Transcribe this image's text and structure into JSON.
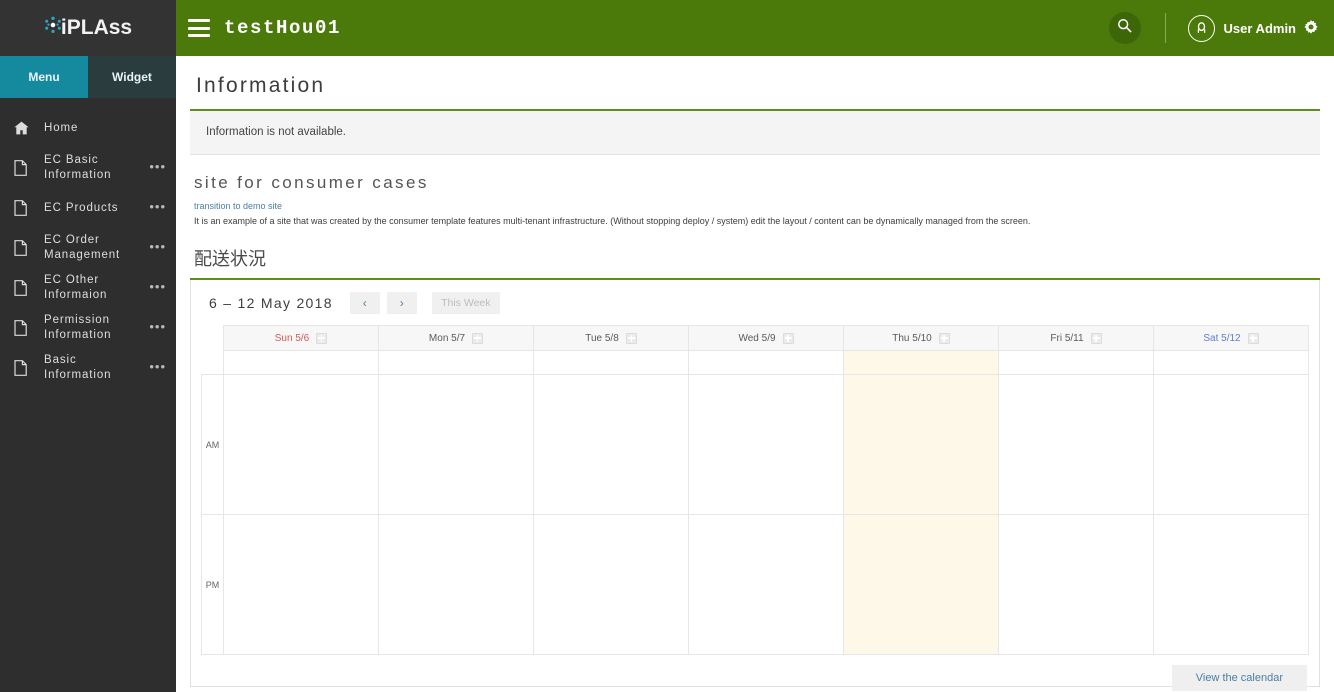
{
  "brand": {
    "logo_text_i": "i",
    "logo_text_rest": "PLAss",
    "burst_color": "#2aa9c4",
    "sidebar_bg": "#2e2e2e"
  },
  "sidebar": {
    "tabs": [
      {
        "label": "Menu",
        "active": true
      },
      {
        "label": "Widget",
        "active": false
      }
    ],
    "items": [
      {
        "label": "Home",
        "icon": "home-icon",
        "dots": ""
      },
      {
        "label": "EC Basic\nInformation",
        "icon": "document-icon",
        "dots": "•••"
      },
      {
        "label": "EC Products",
        "icon": "document-icon",
        "dots": "•••"
      },
      {
        "label": "EC Order\nManagement",
        "icon": "document-icon",
        "dots": "•••"
      },
      {
        "label": "EC Other\nInformaion",
        "icon": "document-icon",
        "dots": "•••"
      },
      {
        "label": "Permission\nInformation",
        "icon": "document-icon",
        "dots": "•••"
      },
      {
        "label": "Basic\nInformation",
        "icon": "document-icon",
        "dots": "•••"
      }
    ]
  },
  "topbar": {
    "tenant_title": "testHou01",
    "user_name": "User Admin",
    "accent_color": "#4b7a0b",
    "search_icon": "search-icon",
    "gear_icon": "gear-icon",
    "avatar_icon": "user-avatar-icon",
    "menu_toggle_icon": "hamburger-icon"
  },
  "content": {
    "page_title": "Information",
    "info_message": "Information is not available.",
    "section_title": "site for consumer cases",
    "demo_link": "transition to demo site",
    "description": "It is an example of a site that was created by the consumer template features multi-tenant infrastructure. (Without stopping deploy / system) edit the layout / content can be dynamically managed from the screen.",
    "calendar_section_title": "配送状況",
    "accent_rule_color": "#5c8f18"
  },
  "calendar": {
    "range_label": "6 – 12 May 2018",
    "prev_label": "‹",
    "next_label": "›",
    "this_week_label": "This Week",
    "view_calendar_label": "View the calendar",
    "today_column_index": 4,
    "today_highlight_color": "#fdf8e8",
    "add_icon": "add-event-icon",
    "days": [
      {
        "label": "Sun 5/6",
        "color_class": "day-red"
      },
      {
        "label": "Mon 5/7",
        "color_class": ""
      },
      {
        "label": "Tue 5/8",
        "color_class": ""
      },
      {
        "label": "Wed 5/9",
        "color_class": ""
      },
      {
        "label": "Thu 5/10",
        "color_class": ""
      },
      {
        "label": "Fri 5/11",
        "color_class": ""
      },
      {
        "label": "Sat 5/12",
        "color_class": "day-blue"
      }
    ],
    "rows": [
      {
        "label": "",
        "type": "allday"
      },
      {
        "label": "AM",
        "type": "slot"
      },
      {
        "label": "PM",
        "type": "slot"
      }
    ]
  }
}
